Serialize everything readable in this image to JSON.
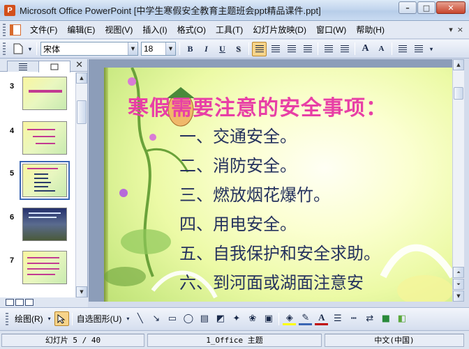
{
  "window": {
    "app_name": "Microsoft Office PowerPoint",
    "document": "[中学生寒假安全教育主题班会ppt精品课件.ppt]",
    "icon_glyph": "P"
  },
  "menu": {
    "items": [
      {
        "label": "文件(F)"
      },
      {
        "label": "编辑(E)"
      },
      {
        "label": "视图(V)"
      },
      {
        "label": "插入(I)"
      },
      {
        "label": "格式(O)"
      },
      {
        "label": "工具(T)"
      },
      {
        "label": "幻灯片放映(D)"
      },
      {
        "label": "窗口(W)"
      },
      {
        "label": "帮助(H)"
      }
    ],
    "close_glyph": "×"
  },
  "format_toolbar": {
    "font_name": "宋体",
    "font_size": "18",
    "bold": "B",
    "italic": "I",
    "underline": "U",
    "shadow": "S",
    "grow_font": "A",
    "shrink_font": "A"
  },
  "thumbnails": [
    {
      "number": "3"
    },
    {
      "number": "4"
    },
    {
      "number": "5"
    },
    {
      "number": "6"
    },
    {
      "number": "7"
    }
  ],
  "slide": {
    "title": "寒假需要注意的安全事项：",
    "bullets": [
      "一、交通安全。",
      "二、消防安全。",
      "三、燃放烟花爆竹。",
      "四、用电安全。",
      "五、自我保护和安全求助。",
      "六、到河面或湖面注意安"
    ]
  },
  "draw_toolbar": {
    "draw_label": "绘图(R)",
    "autoshapes_label": "自选图形(U)"
  },
  "status": {
    "slide_counter": "幻灯片 5 / 40",
    "theme": "1_Office 主题",
    "language": "中文(中国)"
  },
  "colors": {
    "title_pink": "#e83fa6",
    "bullet_navy": "#25325e",
    "selection_blue": "#3a66b4"
  }
}
